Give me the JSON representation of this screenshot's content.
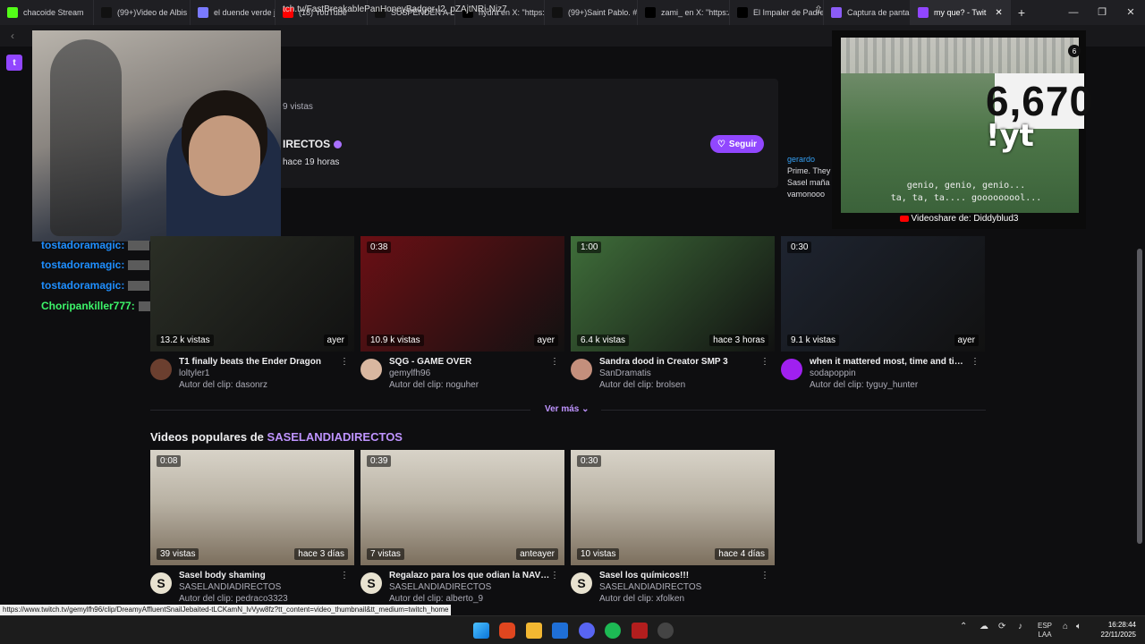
{
  "browser": {
    "tabs": [
      {
        "label": "chacoide Stream",
        "favicon": "kick-icon",
        "color": "#53fc18"
      },
      {
        "label": "(99+)Video de Albis",
        "favicon": "tiktok-icon",
        "color": "#111111"
      },
      {
        "label": "el duende verde jue",
        "favicon": "generic-icon",
        "color": "#7a7aff"
      },
      {
        "label": "(18) YouTube",
        "favicon": "youtube-icon",
        "color": "#ff0000"
      },
      {
        "label": "SUSPENDEN A L",
        "favicon": "tiktok-icon",
        "color": "#111111"
      },
      {
        "label": "hydra en X: \"https:/",
        "favicon": "x-icon",
        "color": "#000000"
      },
      {
        "label": "(99+)Saint Pablo. #",
        "favicon": "tiktok-icon",
        "color": "#111111"
      },
      {
        "label": "zami_ en X: \"https:/",
        "favicon": "x-icon",
        "color": "#000000"
      },
      {
        "label": "El Impaler de Padre",
        "favicon": "x-icon",
        "color": "#000000"
      },
      {
        "label": "Captura de pantalla",
        "favicon": "pen-icon",
        "color": "#8b5cf6"
      },
      {
        "label": "my que? - Twit",
        "favicon": "twitch-icon",
        "color": "#9146ff",
        "active": true
      }
    ],
    "url": "tch.tv/FastBreakablePanHoneyBadger-I2_pZAjtNRi-Niz7",
    "status_url": "https://www.twitch.tv/gemylfh96/clip/DreamyAffluentSnailJebaited-tLCKamN_lvVyw8fz?tt_content=video_thumbnail&tt_medium=twitch_home"
  },
  "top_card": {
    "views": "9 vistas",
    "channel": "IRECTOS",
    "time_ago": "hace 19 horas",
    "follow_label": "Seguir"
  },
  "side_chat": {
    "user": "gerardo",
    "lines": [
      "Prime. They",
      "Sasel maña",
      "vamonooo"
    ]
  },
  "stream_overlay": {
    "counter": "6,670",
    "command": "!yt",
    "lyric1": "genio, genio, genio...",
    "lyric2": "ta, ta, ta.... gooooooool...",
    "share_text": "Videoshare de: Diddyblud3",
    "badge": "6"
  },
  "chat_overlay": [
    {
      "user": "tostadoramagic:",
      "color": "#1f8fff"
    },
    {
      "user": "tostadoramagic:",
      "color": "#1f8fff"
    },
    {
      "user": "tostadoramagic:",
      "color": "#1f8fff"
    },
    {
      "user": "Choripankiller777:",
      "color": "#3df56a"
    }
  ],
  "clips": [
    {
      "duration": "",
      "views": "13.2 k vistas",
      "ago": "ayer",
      "title": "T1 finally beats the Ender Dragon",
      "channel": "loltyler1",
      "author": "Autor del clip: dasonrz",
      "avatar_color": "#6b3f2f",
      "thumb": "#2b2f26"
    },
    {
      "duration": "0:38",
      "views": "10.9 k vistas",
      "ago": "ayer",
      "title": "SQG - GAME OVER",
      "channel": "gemylfh96",
      "author": "Autor del clip: noguher",
      "avatar_color": "#d9b7a0",
      "thumb": "#6b0f14"
    },
    {
      "duration": "1:00",
      "views": "6.4 k vistas",
      "ago": "hace 3 horas",
      "title": "Sandra dood in Creator SMP 3",
      "channel": "SanDramatis",
      "author": "Autor del clip: brolsen",
      "avatar_color": "#c48f7c",
      "thumb": "#3f6e3a"
    },
    {
      "duration": "0:30",
      "views": "9.1 k vistas",
      "ago": "ayer",
      "title": "when it mattered most, time and time ...",
      "channel": "sodapoppin",
      "author": "Autor del clip: tyguy_hunter",
      "avatar_color": "#a020f0",
      "thumb": "#1e2430"
    }
  ],
  "ver_mas": "Ver más",
  "popular": {
    "prefix": "Videos populares de ",
    "channel": "SASELANDIADIRECTOS",
    "videos": [
      {
        "duration": "0:08",
        "views": "39 vistas",
        "ago": "hace 3 días",
        "title": "Sasel body shaming",
        "channel": "SASELANDIADIRECTOS",
        "author": "Autor del clip: pedraco3323"
      },
      {
        "duration": "0:39",
        "views": "7 vistas",
        "ago": "anteayer",
        "title": "Regalazo para los que odian la NAVID...",
        "channel": "SASELANDIADIRECTOS",
        "author": "Autor del clip: alberto_9"
      },
      {
        "duration": "0:30",
        "views": "10 vistas",
        "ago": "hace 4 días",
        "title": "Sasel los químicos!!!",
        "channel": "SASELANDIADIRECTOS",
        "author": "Autor del clip: xfolken"
      }
    ]
  },
  "taskbar": {
    "lang": "ESP",
    "layout": "LAA",
    "time": "16:28:44",
    "date": "22/11/2025"
  }
}
